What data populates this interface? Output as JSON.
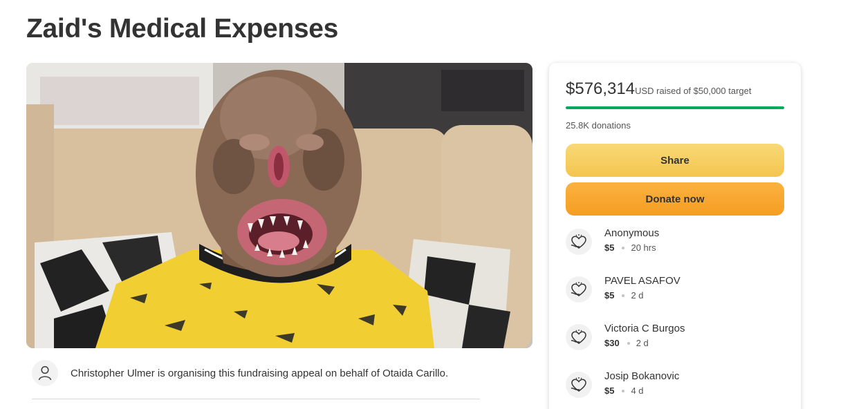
{
  "page": {
    "title": "Zaid's Medical Expenses"
  },
  "hero": {
    "image_label": "campaign-photo"
  },
  "organiser": {
    "text": "Christopher Ulmer is organising this fundraising appeal on behalf of Otaida Carillo.",
    "icon": "person-icon"
  },
  "summary": {
    "raised_amount": "$576,314",
    "raised_suffix": "USD raised of $50,000 target",
    "progress_fraction": 1.0,
    "donations_count": "25.8K donations"
  },
  "actions": {
    "share_label": "Share",
    "donate_label": "Donate now"
  },
  "donations": [
    {
      "name": "Anonymous",
      "amount": "$5",
      "time": "20 hrs"
    },
    {
      "name": "PAVEL ASAFOV",
      "amount": "$5",
      "time": "2 d"
    },
    {
      "name": "Victoria C Burgos",
      "amount": "$30",
      "time": "2 d"
    },
    {
      "name": "Josip Bokanovic",
      "amount": "$5",
      "time": "4 d"
    }
  ],
  "colors": {
    "progress": "#02a95c",
    "share_button": "#f6cf63",
    "donate_button": "#f8a72f",
    "text": "#333333"
  }
}
